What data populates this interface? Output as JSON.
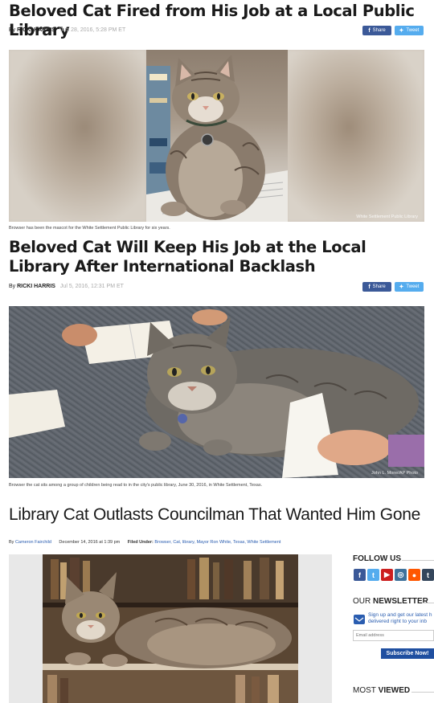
{
  "article1": {
    "headline": "Beloved Cat Fired from His Job at a Local Public Library",
    "byline_prefix": "By",
    "author": "RICKI HARRIS",
    "date": "Jun 28, 2016, 5:28 PM ET",
    "share_facebook": "Share",
    "share_twitter": "Tweet",
    "photo_credit": "White Settlement Public Library",
    "caption": "Browser has been the mascot for the White Settlement Public Library for six years."
  },
  "article2": {
    "headline": "Beloved Cat Will Keep His Job at the Local Library After International Backlash",
    "byline_prefix": "By",
    "author": "RICKI HARRIS",
    "date": "Jul 5, 2016, 12:31 PM ET",
    "share_facebook": "Share",
    "share_twitter": "Tweet",
    "photo_credit": "John L. Mone/AP Photo",
    "caption": "Browser the cat sits among a group of children being read to in the city's public library, June 30, 2016, in White Settlement, Texas."
  },
  "article3": {
    "headline": "Library Cat Outlasts Councilman That Wanted Him Gone",
    "byline_prefix": "By",
    "author": "Cameron Fairchild",
    "date": "December 14, 2016 at 1:39 pm",
    "filed_label": "Filed Under:",
    "tags": "Browser, Cat, library, Mayor Ron White, Texas, White Settlement"
  },
  "sidebar": {
    "follow_title": "FOLLOW US",
    "newsletter_title_our": "OUR",
    "newsletter_title_main": "NEWSLETTER",
    "newsletter_text_1": "Sign up and get our latest h",
    "newsletter_text_2": "delivered right to your inb",
    "email_placeholder": "Email address",
    "subscribe_label": "Subscribe Now!",
    "most_viewed_title_most": "MOST",
    "most_viewed_title_viewed": "VIEWED",
    "social_icons": [
      "facebook-icon",
      "twitter-icon",
      "youtube-icon",
      "instagram-icon",
      "reddit-icon",
      "tumblr-icon"
    ]
  },
  "colors": {
    "facebook": "#3b5998",
    "twitter": "#55acee",
    "link_blue": "#2a5db0"
  }
}
